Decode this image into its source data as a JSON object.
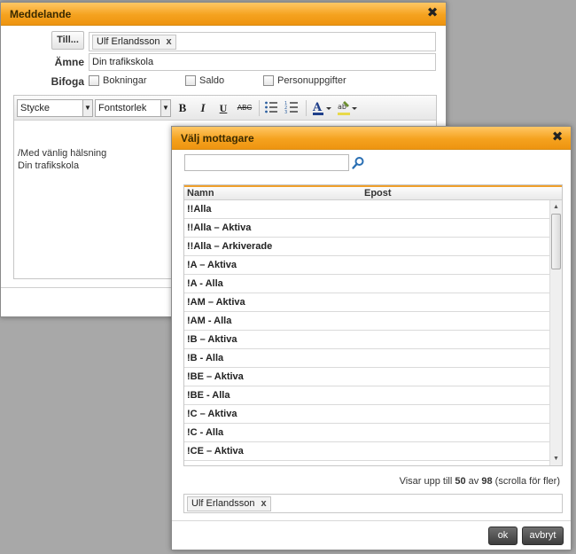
{
  "message_dialog": {
    "title": "Meddelande",
    "close_glyph": "✖",
    "to_button": "Till...",
    "to_chip": "Ulf Erlandsson",
    "chip_remove": "x",
    "subject_label": "Ämne",
    "subject_value": "Din trafikskola",
    "attach_label": "Bifoga",
    "attach_options": [
      "Bokningar",
      "Saldo",
      "Personuppgifter"
    ],
    "editor": {
      "style_select": "Stycke",
      "size_select": "Fontstorlek",
      "bold": "B",
      "italic": "I",
      "underline": "U",
      "strike": "ABC",
      "body_line1": "/Med vänlig hälsning",
      "body_line2": "Din trafikskola"
    }
  },
  "recipient_dialog": {
    "title": "Välj mottagare",
    "close_glyph": "✖",
    "search_value": "",
    "columns": [
      "Namn",
      "Epost"
    ],
    "rows": [
      "!!Alla",
      "!!Alla – Aktiva",
      "!!Alla – Arkiverade",
      "!A – Aktiva",
      "!A - Alla",
      "!AM – Aktiva",
      "!AM - Alla",
      "!B – Aktiva",
      "!B - Alla",
      "!BE – Aktiva",
      "!BE - Alla",
      "!C – Aktiva",
      "!C - Alla",
      "!CE – Aktiva"
    ],
    "showing": {
      "prefix": "Visar upp till",
      "shown": "50",
      "middle": "av",
      "total": "98",
      "suffix": "(scrolla för fler)"
    },
    "selected_chip": "Ulf Erlandsson",
    "chip_remove": "x",
    "ok_button": "ok",
    "cancel_button": "avbryt"
  },
  "colors": {
    "titlebar": "#f5a21f",
    "header_accent": "#f0a02c",
    "button_dark": "#4a4a4a",
    "search_icon": "#2a6fb3"
  }
}
